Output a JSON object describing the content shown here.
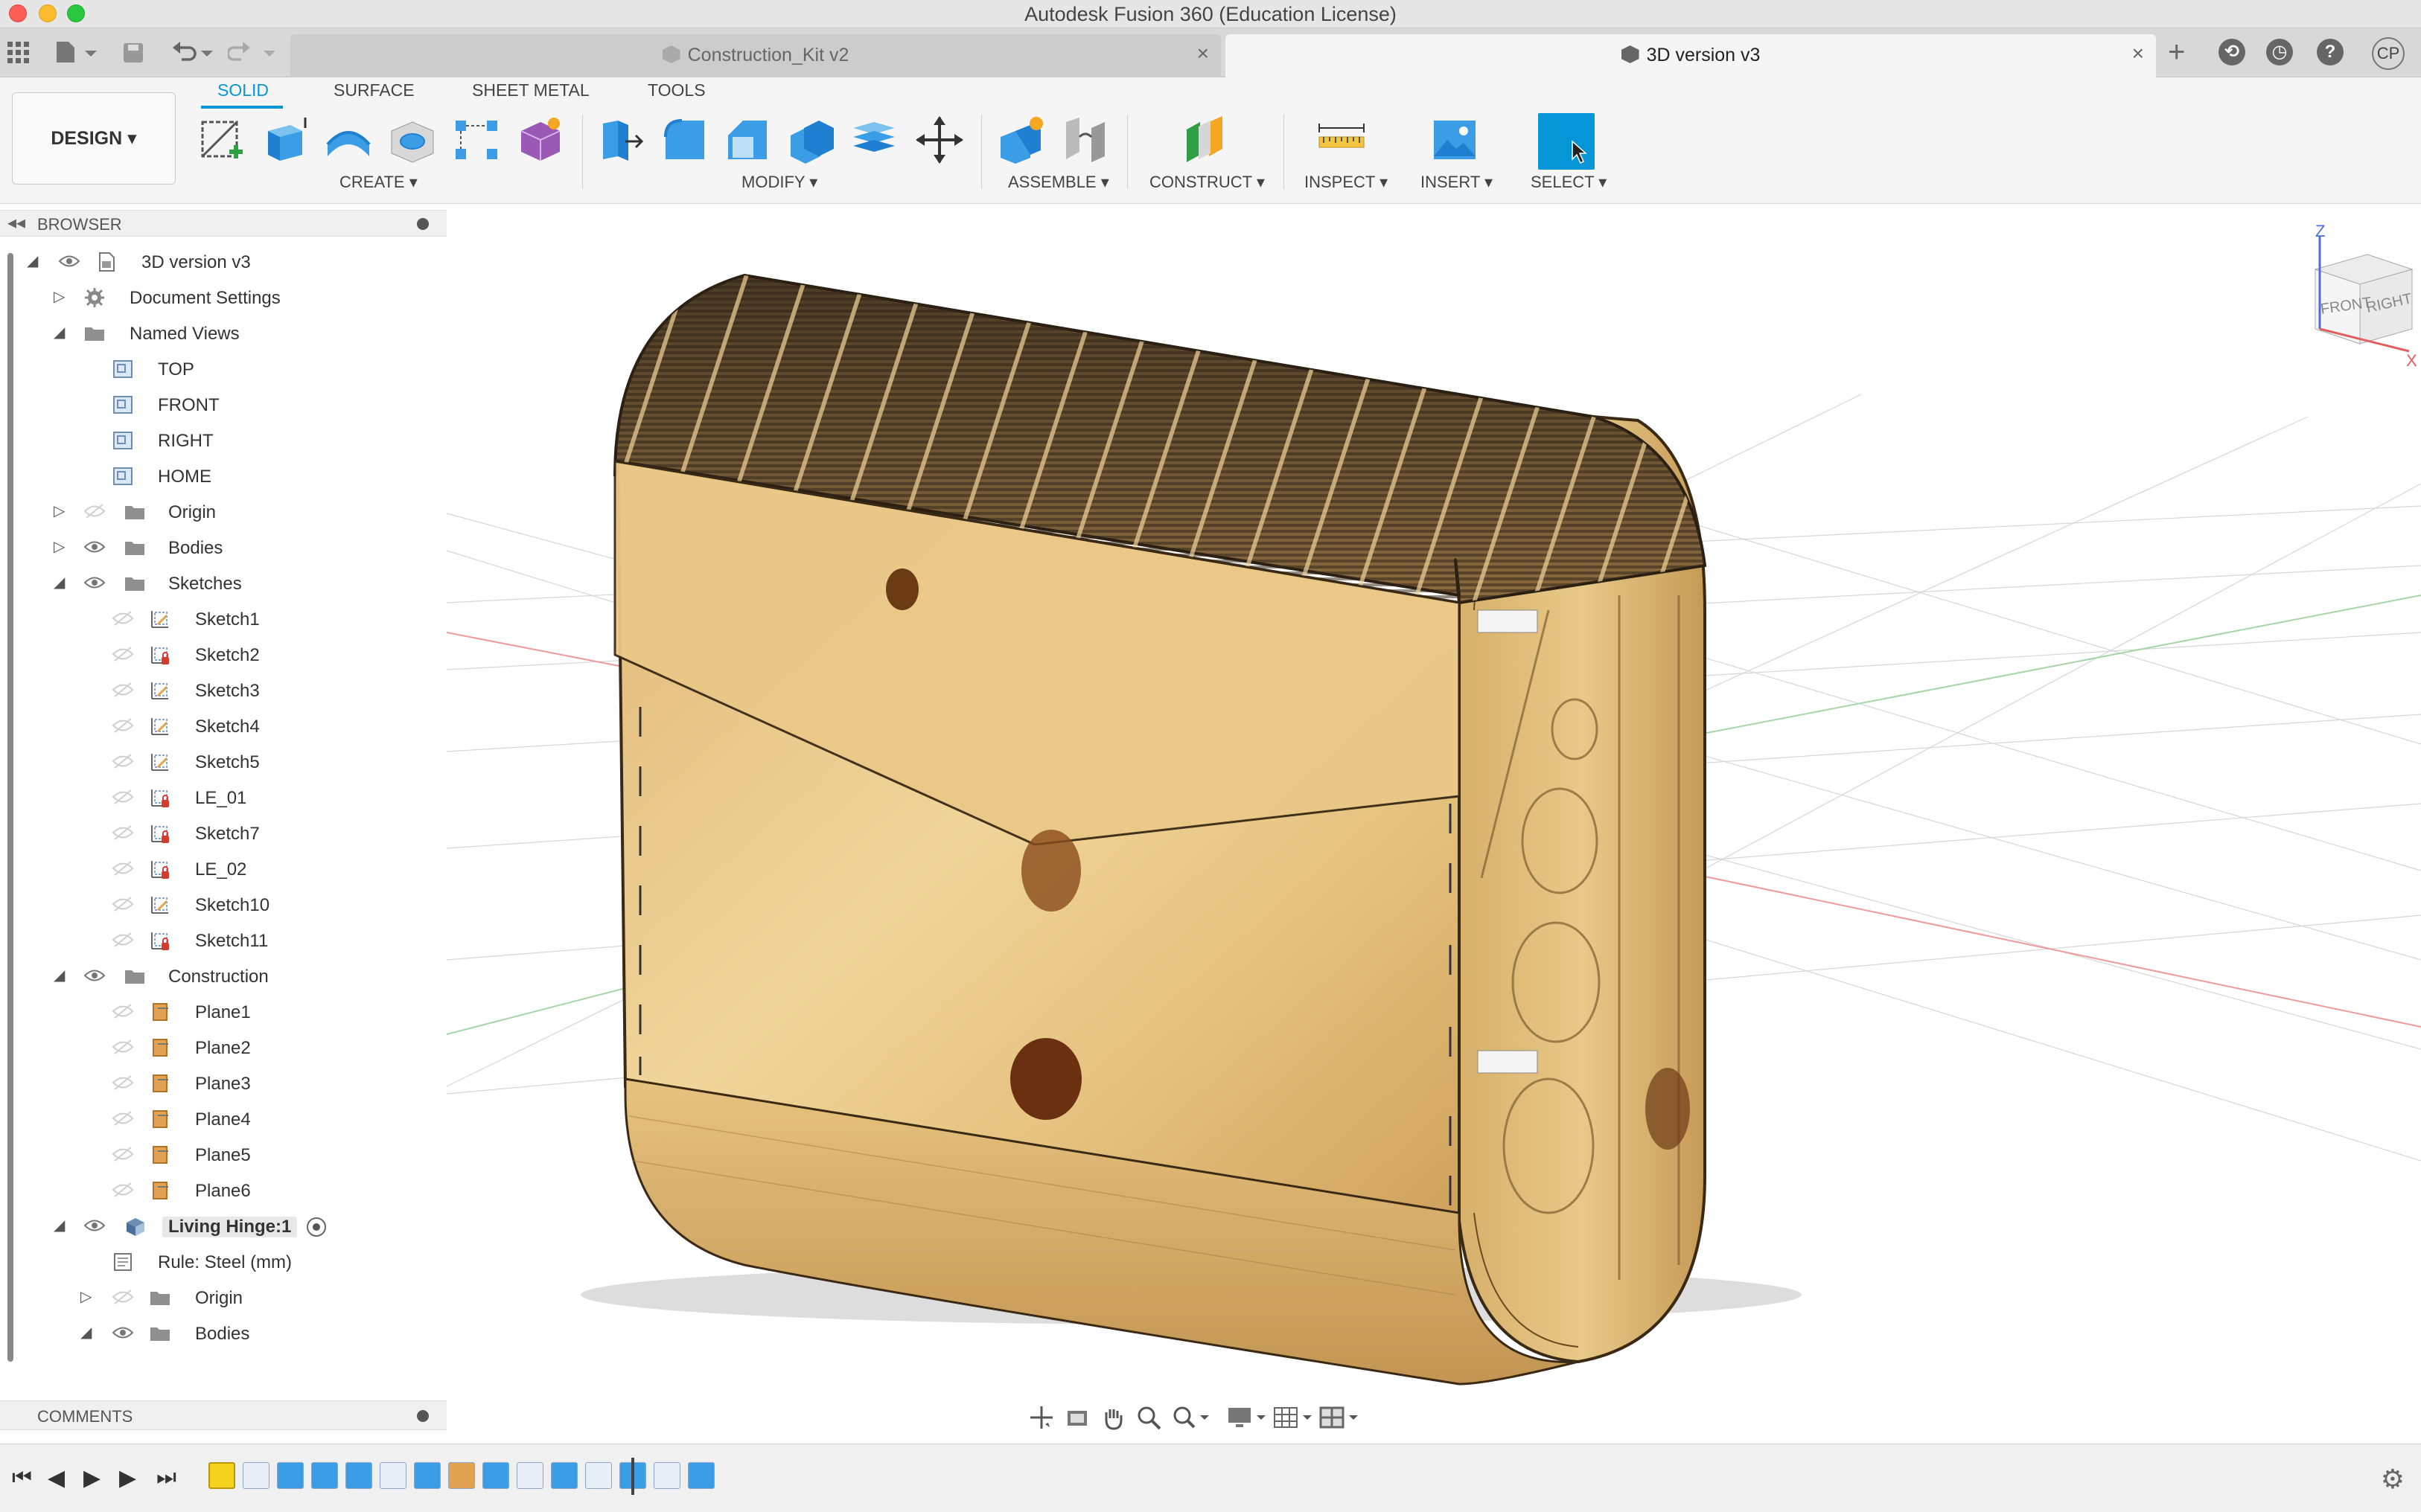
{
  "window": {
    "title": "Autodesk Fusion 360 (Education License)"
  },
  "tabs": [
    {
      "label": "Construction_Kit v2",
      "active": false
    },
    {
      "label": "3D version v3",
      "active": true
    }
  ],
  "user": {
    "initials": "CP"
  },
  "workspace": {
    "label": "DESIGN ▾"
  },
  "mode_tabs": [
    "SOLID",
    "SURFACE",
    "SHEET METAL",
    "TOOLS"
  ],
  "tool_groups": {
    "create": "CREATE ▾",
    "modify": "MODIFY ▾",
    "assemble": "ASSEMBLE ▾",
    "construct": "CONSTRUCT ▾",
    "inspect": "INSPECT ▾",
    "insert": "INSERT ▾",
    "select": "SELECT ▾"
  },
  "browser": {
    "title": "BROWSER",
    "collapse_glyph": "◂◂",
    "root": "3D version v3",
    "document_settings": "Document Settings",
    "named_views": {
      "label": "Named Views",
      "items": [
        "TOP",
        "FRONT",
        "RIGHT",
        "HOME"
      ]
    },
    "origin": "Origin",
    "bodies": "Bodies",
    "sketches": {
      "label": "Sketches",
      "items": [
        "Sketch1",
        "Sketch2",
        "Sketch3",
        "Sketch4",
        "Sketch5",
        "LE_01",
        "Sketch7",
        "LE_02",
        "Sketch10",
        "Sketch11"
      ]
    },
    "construction": {
      "label": "Construction",
      "items": [
        "Plane1",
        "Plane2",
        "Plane3",
        "Plane4",
        "Plane5",
        "Plane6"
      ]
    },
    "component": {
      "label": "Living Hinge:1",
      "rule": "Rule: Steel (mm)",
      "origin": "Origin",
      "bodies": "Bodies"
    }
  },
  "comments": {
    "title": "COMMENTS"
  },
  "viewcube": {
    "front": "FRONT",
    "right": "RIGHT",
    "z": "Z",
    "x": "X"
  },
  "icons": {
    "apps": "apps-grid-icon",
    "file": "file-icon",
    "save": "save-icon",
    "undo": "undo-icon",
    "redo": "redo-icon",
    "new_tab": "plus-icon",
    "extensions": "extensions-icon",
    "job_status": "clock-icon",
    "help": "help-icon",
    "settings": "gear-icon"
  },
  "colors": {
    "accent": "#0696d7",
    "wood": "#d9b36a",
    "wood_dark": "#a97c3a",
    "sketch_red": "#d33b2c",
    "plane_orange": "#e3a251"
  }
}
